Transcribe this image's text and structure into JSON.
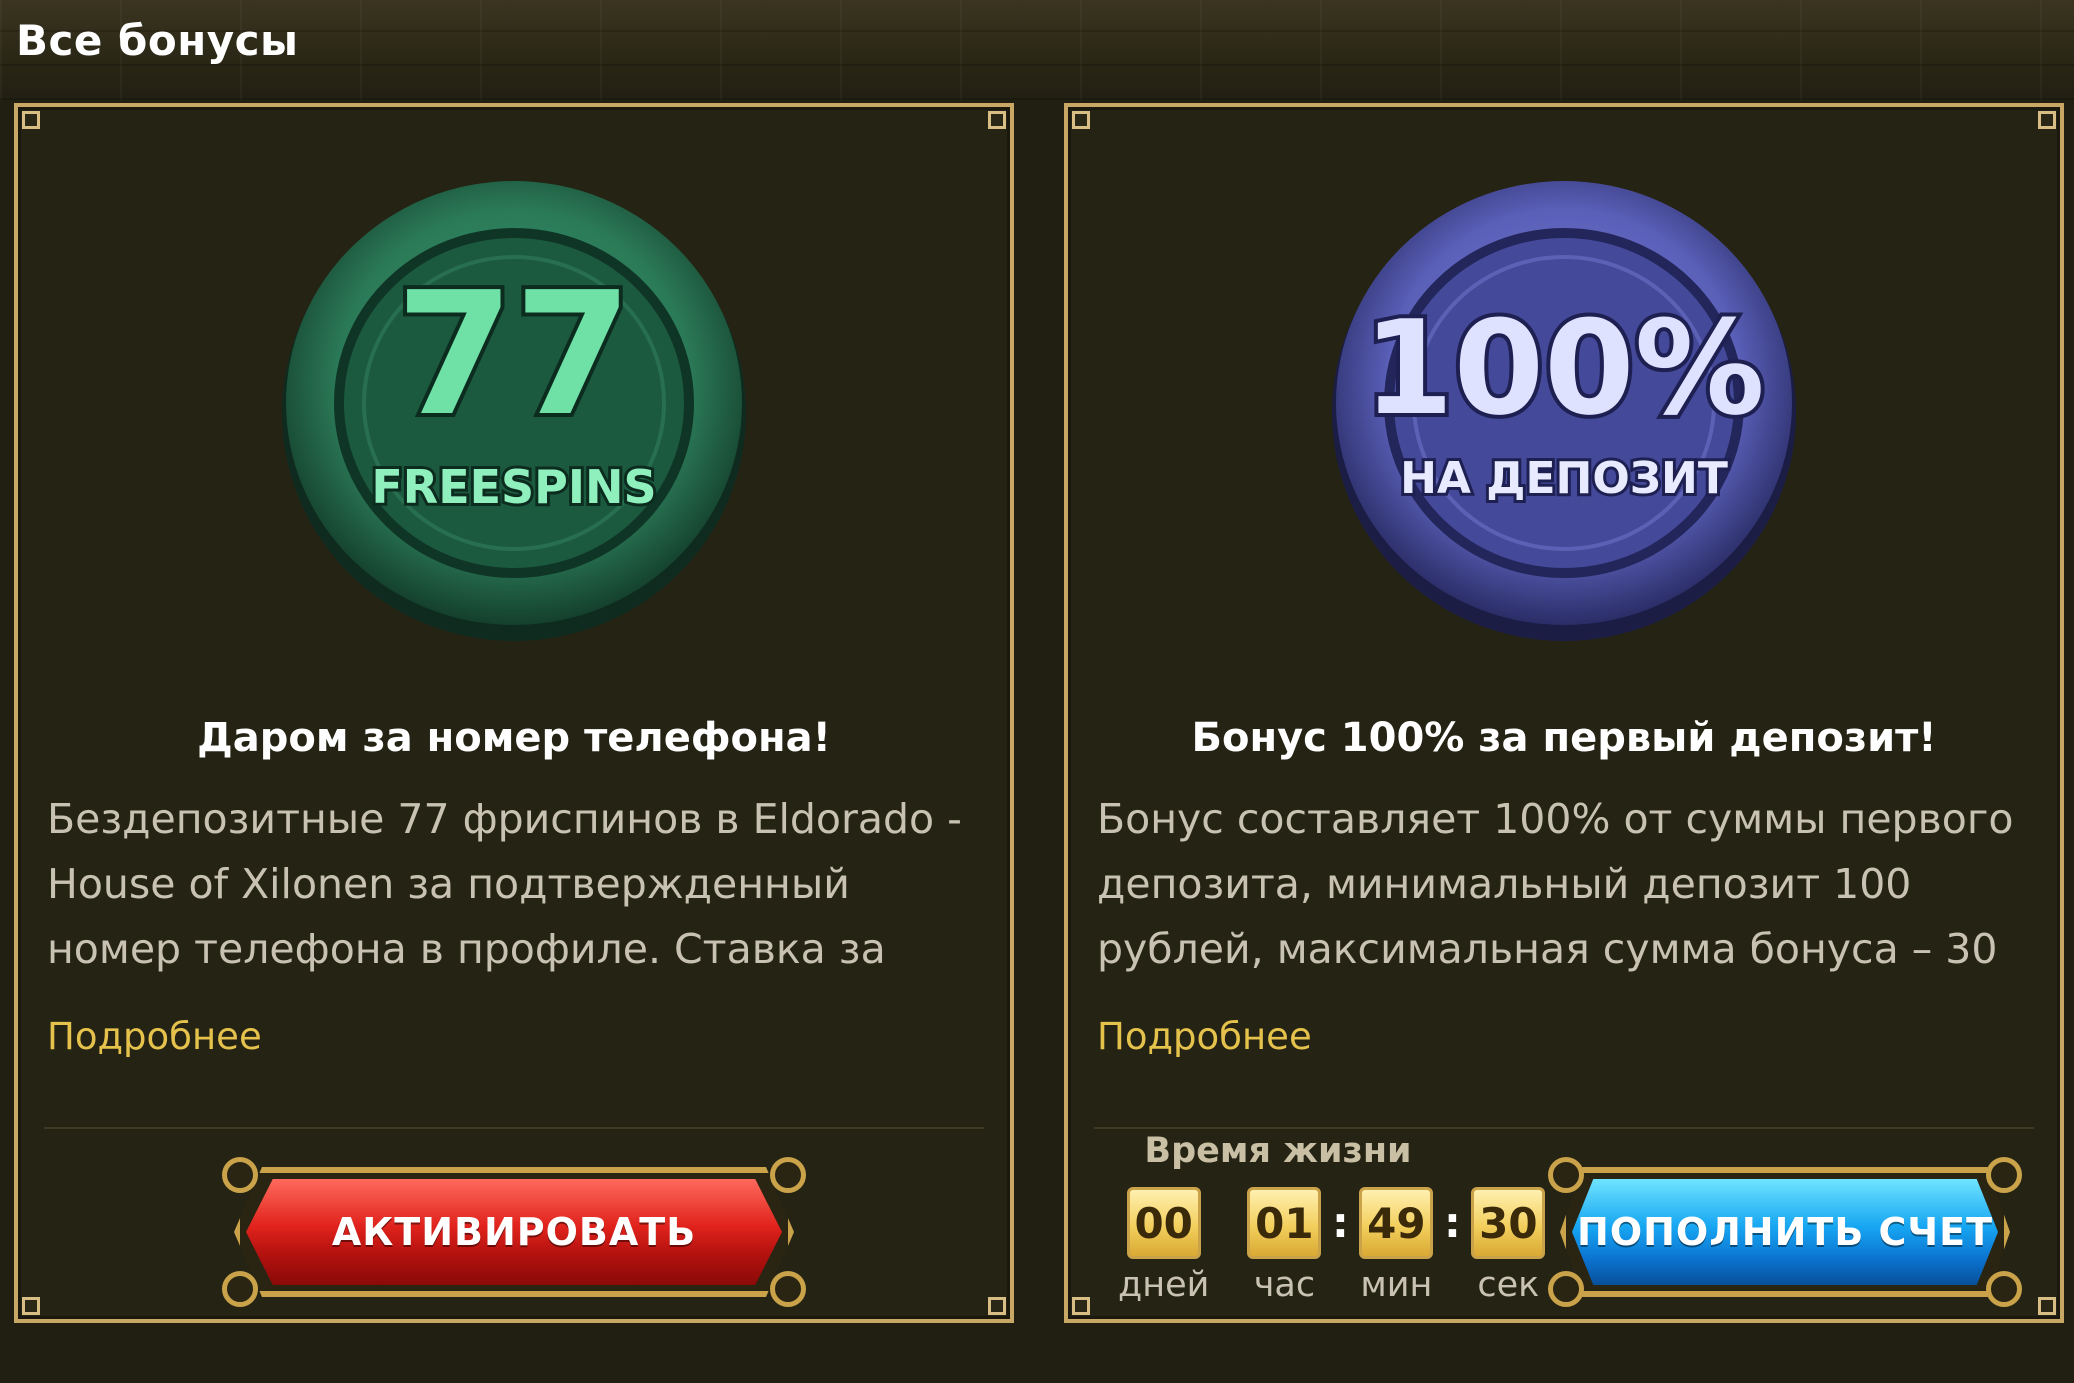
{
  "page": {
    "title": "Все бонусы"
  },
  "cards": [
    {
      "coin": {
        "icon": "freespins-coin-icon",
        "number": "77",
        "caption": "FREESPINS",
        "color": "#2f8a62"
      },
      "title": "Даром за номер телефона!",
      "description": "Бездепозитные 77 фриспинов в Eldorado - House of Xilonen за подтвержденный номер телефона в профиле. Ставка за спин",
      "more_label": "Подробнее",
      "button_label": "АКТИВИРОВАТЬ",
      "button_color": "#e0221c"
    },
    {
      "coin": {
        "icon": "deposit-coin-icon",
        "number": "100%",
        "caption": "НА ДЕПОЗИТ",
        "color": "#5a5fb8"
      },
      "title": "Бонус 100% за первый депозит!",
      "description": "Бонус составляет 100% от суммы первого депозита, минимальный депозит 100 рублей, максимальная сумма бонуса – 30",
      "more_label": "Подробнее",
      "button_label": "ПОПОЛНИТЬ СЧЕТ",
      "button_color": "#17a6f2",
      "timer": {
        "title": "Время жизни",
        "days": "00",
        "days_label": "дней",
        "hours": "01",
        "hours_label": "час",
        "minutes": "49",
        "minutes_label": "мин",
        "seconds": "30",
        "seconds_label": "сек",
        "separator": ":"
      }
    }
  ]
}
